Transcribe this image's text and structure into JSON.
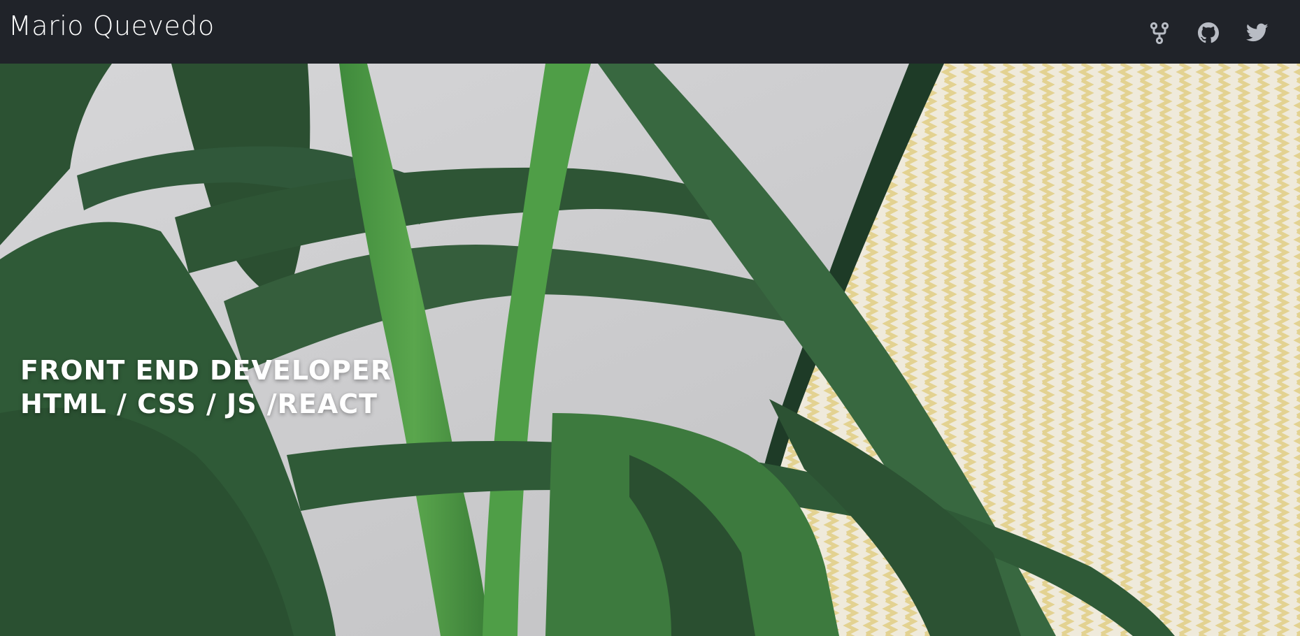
{
  "header": {
    "brand": "Mario Quevedo",
    "icons": [
      "fork-icon",
      "github-icon",
      "twitter-icon"
    ]
  },
  "hero": {
    "line1": "Front End Developer",
    "line2": "HTML / CSS / JS /REACT"
  },
  "colors": {
    "navbar": "#202329",
    "icon": "#b8bcc4",
    "hero_text": "#ffffff",
    "leaf_dark": "#2f5a36",
    "leaf_bright": "#4e9a45",
    "wall": "#cfcfd1",
    "zigzag_yellow": "#e6d79a"
  }
}
